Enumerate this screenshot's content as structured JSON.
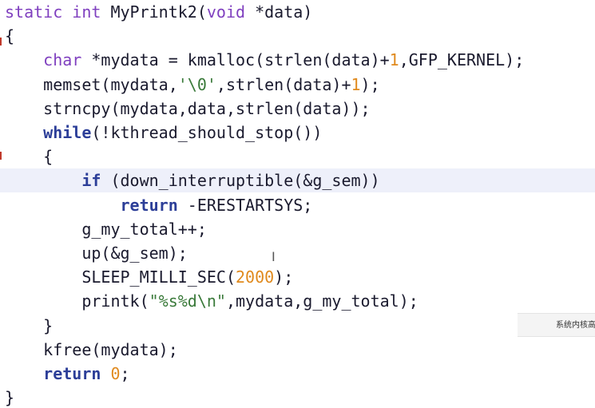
{
  "editor": {
    "lines": [
      [
        {
          "t": "static int ",
          "c": "kw"
        },
        {
          "t": "MyPrintk2(",
          "c": "p"
        },
        {
          "t": "void",
          "c": "kw"
        },
        {
          "t": " *data)",
          "c": "p"
        }
      ],
      [
        {
          "t": "{",
          "c": "p"
        }
      ],
      [
        {
          "t": "    ",
          "c": "p"
        },
        {
          "t": "char",
          "c": "kw"
        },
        {
          "t": " *mydata = kmalloc(strlen(data)+",
          "c": "p"
        },
        {
          "t": "1",
          "c": "num"
        },
        {
          "t": ",GFP_KERNEL);",
          "c": "p"
        }
      ],
      [
        {
          "t": "    memset(mydata,",
          "c": "p"
        },
        {
          "t": "'\\0'",
          "c": "str"
        },
        {
          "t": ",strlen(data)+",
          "c": "p"
        },
        {
          "t": "1",
          "c": "num"
        },
        {
          "t": ");",
          "c": "p"
        }
      ],
      [
        {
          "t": "    strncpy(mydata,data,strlen(data));",
          "c": "p"
        }
      ],
      [
        {
          "t": "    ",
          "c": "p"
        },
        {
          "t": "while",
          "c": "bold"
        },
        {
          "t": "(!kthread_should_stop())",
          "c": "p"
        }
      ],
      [
        {
          "t": "    {",
          "c": "p"
        }
      ],
      [
        {
          "t": "        ",
          "c": "p"
        },
        {
          "t": "if",
          "c": "bold"
        },
        {
          "t": " (down_interruptible(&g_sem))",
          "c": "p"
        }
      ],
      [
        {
          "t": "            ",
          "c": "p"
        },
        {
          "t": "return",
          "c": "bold"
        },
        {
          "t": " -ERESTARTSYS;",
          "c": "p"
        }
      ],
      [
        {
          "t": "        g_my_total++;",
          "c": "p"
        }
      ],
      [
        {
          "t": "        up(&g_sem);",
          "c": "p"
        }
      ],
      [
        {
          "t": "        SLEEP_MILLI_SEC(",
          "c": "p"
        },
        {
          "t": "2000",
          "c": "num"
        },
        {
          "t": ");",
          "c": "p"
        }
      ],
      [
        {
          "t": "        printk(",
          "c": "p"
        },
        {
          "t": "\"%s%d\\n\"",
          "c": "str"
        },
        {
          "t": ",mydata,g_my_total);",
          "c": "p"
        }
      ],
      [
        {
          "t": "    }",
          "c": "p"
        }
      ],
      [
        {
          "t": "    kfree(mydata);",
          "c": "p"
        }
      ],
      [
        {
          "t": "    ",
          "c": "p"
        },
        {
          "t": "return",
          "c": "bold"
        },
        {
          "t": " ",
          "c": "p"
        },
        {
          "t": "0",
          "c": "num"
        },
        {
          "t": ";",
          "c": "p"
        }
      ],
      [
        {
          "t": "}",
          "c": "p"
        }
      ]
    ],
    "highlighted_line": 7
  },
  "tooltip": {
    "text": "系统内核高"
  },
  "colors": {
    "keyword": "#7f3fbf",
    "control": "#2c3e98",
    "string": "#3a7a3a",
    "number": "#e08a1e",
    "highlight": "#eef0fa"
  }
}
